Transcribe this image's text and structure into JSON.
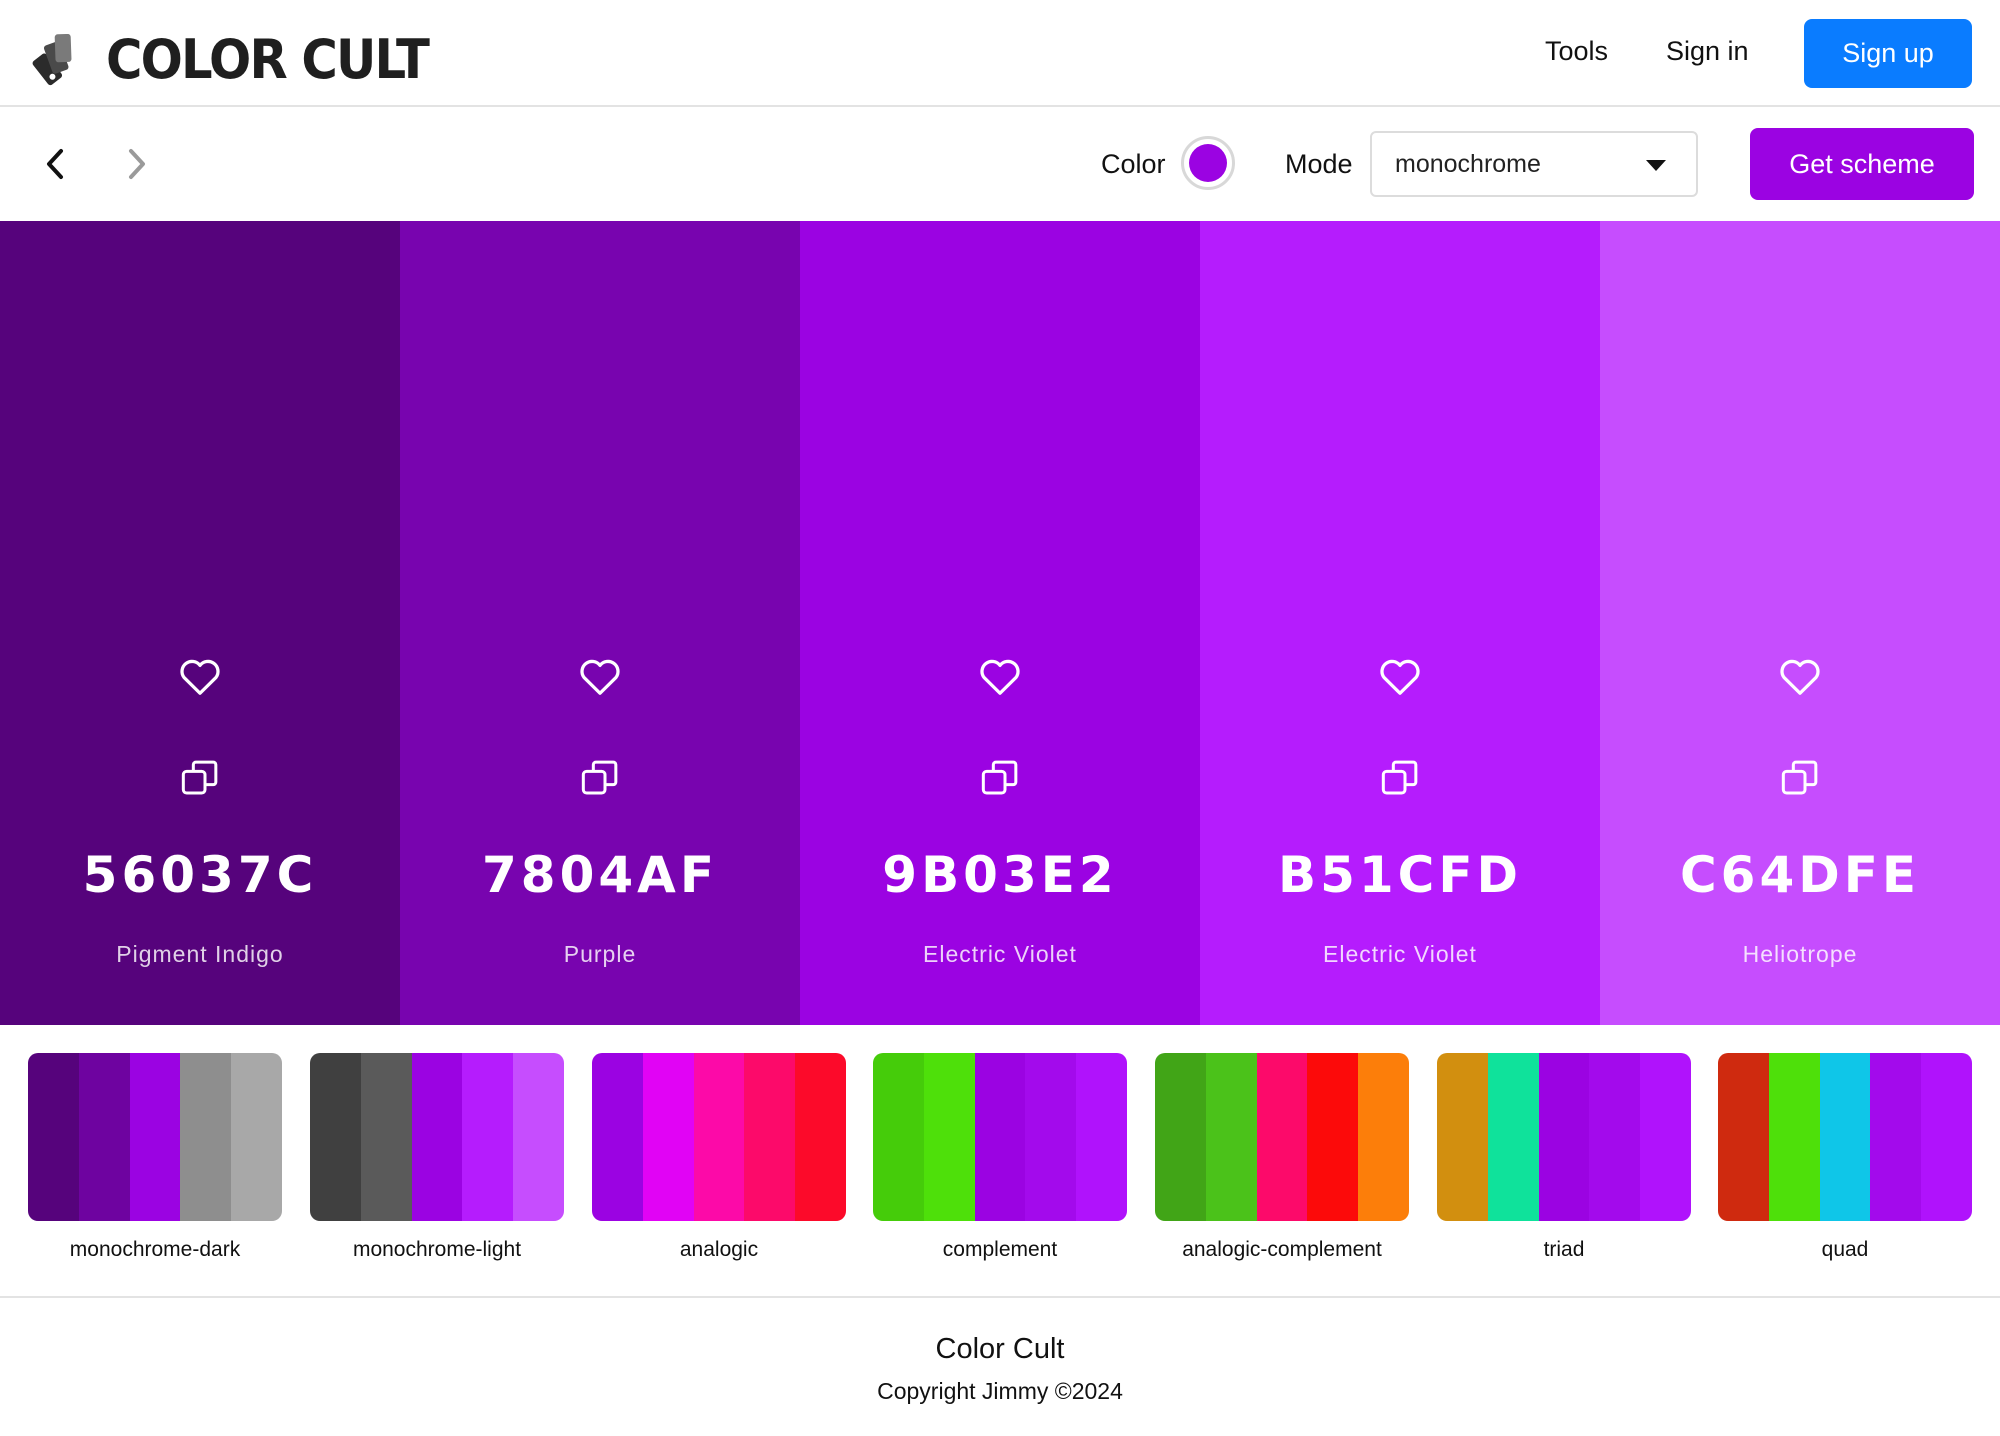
{
  "header": {
    "brand": "COLOR CULT",
    "nav": {
      "tools": "Tools",
      "signin": "Sign in",
      "signup": "Sign up"
    },
    "signup_color": "#0a7cff"
  },
  "toolbar": {
    "color_label": "Color",
    "color_value": "#9b03e2",
    "mode_label": "Mode",
    "mode_value": "monochrome",
    "get_scheme_label": "Get scheme",
    "get_scheme_color": "#9b03e2"
  },
  "scheme": {
    "colors": [
      {
        "hex": "56037C",
        "name": "Pigment Indigo",
        "bg": "#56037c"
      },
      {
        "hex": "7804AF",
        "name": "Purple",
        "bg": "#7804af"
      },
      {
        "hex": "9B03E2",
        "name": "Electric Violet",
        "bg": "#9b03e2"
      },
      {
        "hex": "B51CFD",
        "name": "Electric Violet",
        "bg": "#b51cfd"
      },
      {
        "hex": "C64DFE",
        "name": "Heliotrope",
        "bg": "#c64dfe"
      }
    ]
  },
  "modes": [
    {
      "label": "monochrome-dark",
      "colors": [
        "#56037c",
        "#6e03a0",
        "#9b03e2",
        "#8e8e8e",
        "#a8a8a8"
      ]
    },
    {
      "label": "monochrome-light",
      "colors": [
        "#404040",
        "#5a5a5a",
        "#9b03e2",
        "#b51cfd",
        "#c64dfe"
      ]
    },
    {
      "label": "analogic",
      "colors": [
        "#9b03e2",
        "#e103f5",
        "#fc0aa8",
        "#fc0a6a",
        "#fc0a2a"
      ]
    },
    {
      "label": "complement",
      "colors": [
        "#45cc0a",
        "#4ee00a",
        "#9b03e2",
        "#a30aec",
        "#b012fc"
      ]
    },
    {
      "label": "analogic-complement",
      "colors": [
        "#41a517",
        "#4bc21a",
        "#fc0a6a",
        "#fc0a0a",
        "#fc7e0a"
      ]
    },
    {
      "label": "triad",
      "colors": [
        "#d28f0f",
        "#0fe29b",
        "#9b03e2",
        "#a30aec",
        "#b012fc"
      ]
    },
    {
      "label": "quad",
      "colors": [
        "#cf2a0f",
        "#4ee00a",
        "#0fc6e8",
        "#a30aec",
        "#b012fc"
      ]
    }
  ],
  "footer": {
    "title": "Color Cult",
    "copyright": "Copyright Jimmy ©2024"
  },
  "icons": {
    "logo": "swatch-logo-icon",
    "prev": "chevron-left-icon",
    "next": "chevron-right-icon",
    "favorite": "heart-icon",
    "copy": "copy-icon",
    "dropdown": "caret-down-icon"
  }
}
